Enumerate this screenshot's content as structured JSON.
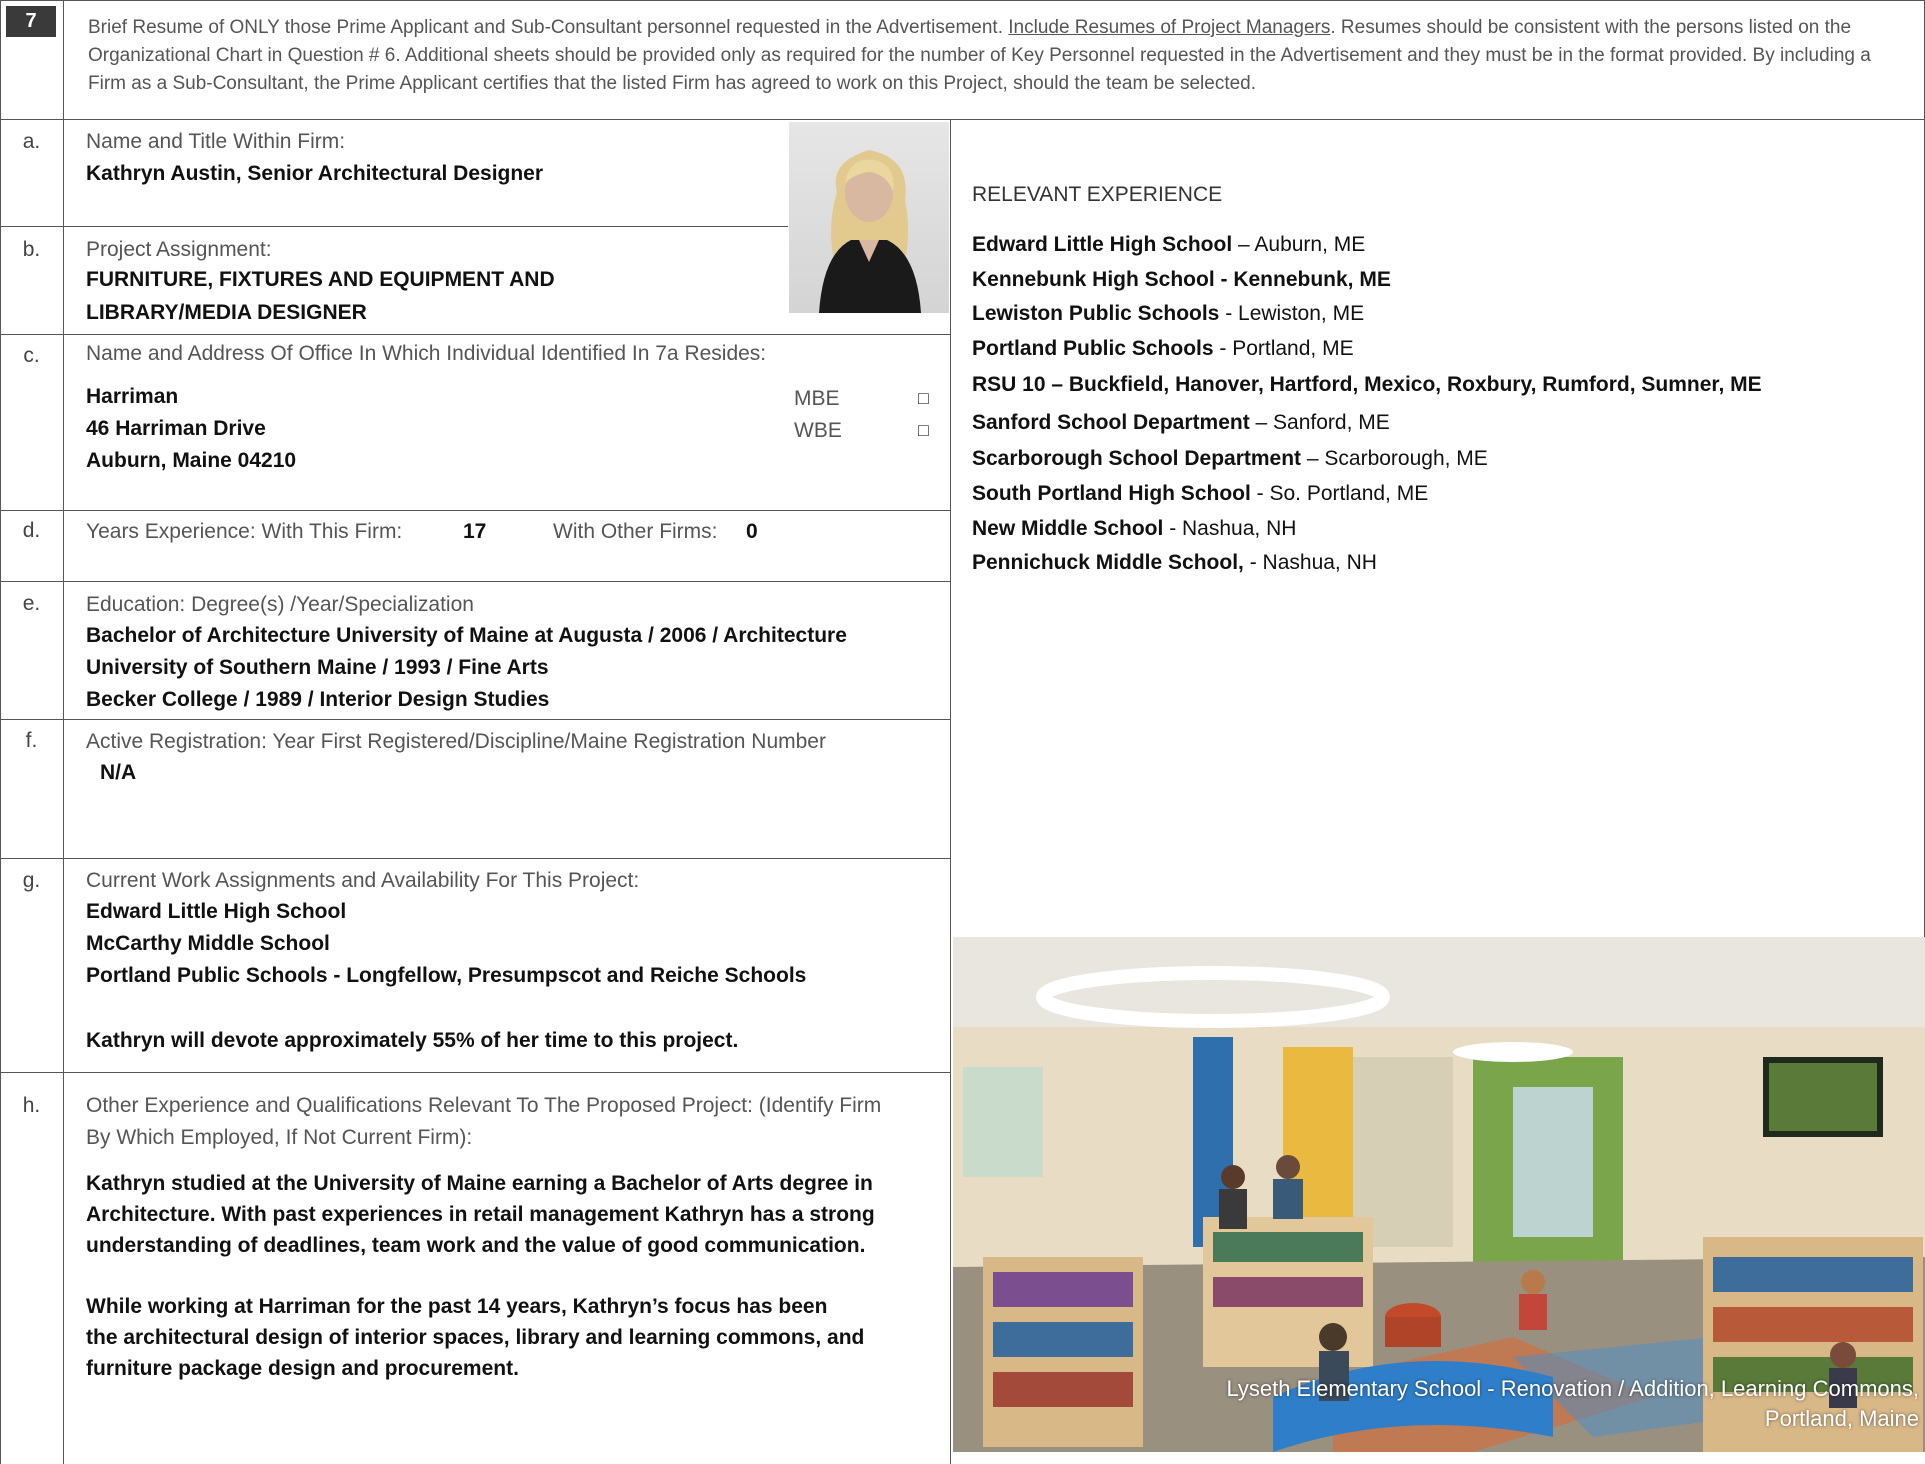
{
  "header": {
    "number": "7",
    "text_before": "Brief Resume of ONLY those Prime Applicant and Sub-Consultant personnel requested in the Advertisement. ",
    "text_underlined": "Include Resumes of Project Managers",
    "text_after": ". Resumes should be consistent with the persons listed on the Organizational Chart in Question # 6. Additional sheets should be provided only as required for the number of Key Personnel requested in the Advertisement and they must be in the format provided. By including a Firm as a Sub-Consultant, the Prime Applicant certifies that the listed Firm has agreed to work on this Project, should the team be selected."
  },
  "sections": {
    "a": {
      "letter": "a.",
      "label": "Name and Title Within Firm:",
      "value": "Kathryn Austin, Senior Architectural Designer"
    },
    "b": {
      "letter": "b.",
      "label": "Project Assignment:",
      "line1": "FURNITURE, FIXTURES AND EQUIPMENT AND",
      "line2": "LIBRARY/MEDIA DESIGNER"
    },
    "c": {
      "letter": "c.",
      "label": "Name and Address Of Office In Which Individual Identified In 7a Resides:",
      "lines": [
        "Harriman",
        "46 Harriman Drive",
        "Auburn, Maine 04210"
      ],
      "mbe": "MBE",
      "wbe": "WBE",
      "checkbox": "□"
    },
    "d": {
      "letter": "d.",
      "label": "Years Experience:  With This Firm:",
      "firm_years": "17",
      "other_label": "With Other Firms:",
      "other_years": "0"
    },
    "e": {
      "letter": "e.",
      "label": "Education:  Degree(s) /Year/Specialization",
      "lines": [
        "Bachelor of Architecture University of Maine at Augusta / 2006 / Architecture",
        "University of Southern Maine / 1993 / Fine Arts",
        "Becker College / 1989 / Interior Design Studies"
      ]
    },
    "f": {
      "letter": "f.",
      "label": "Active Registration:  Year First Registered/Discipline/Maine Registration Number",
      "value": "N/A"
    },
    "g": {
      "letter": "g.",
      "label": "Current Work Assignments and Availability For This Project:",
      "lines": [
        "Edward Little High School",
        "McCarthy Middle School",
        "Portland Public Schools - Longfellow, Presumpscot and Reiche Schools"
      ],
      "availability": "Kathryn will devote approximately 55% of her time to this project."
    },
    "h": {
      "letter": "h.",
      "label_line1": "Other Experience and Qualifications Relevant To The Proposed Project: (Identify Firm",
      "label_line2": "By Which Employed, If Not Current Firm):",
      "para1": [
        "Kathryn studied at the University of Maine earning a Bachelor of Arts degree in",
        "Architecture. With past experiences in retail management Kathryn has a strong",
        "understanding of deadlines, team work and the value of good communication."
      ],
      "para2_bold": "While working at Harriman for the past 14 years, Kathryn’s focus has been",
      "para2": [
        "the architectural design of interior spaces, library and learning commons, and",
        "furniture package design and procurement."
      ]
    }
  },
  "experience": {
    "title": "RELEVANT EXPERIENCE",
    "items": [
      {
        "name": "Edward Little High School",
        "loc": " – Auburn, ME",
        "all_bold": false
      },
      {
        "name": "Kennebunk High School - Kennebunk, ME",
        "loc": "",
        "all_bold": true
      },
      {
        "name": "Lewiston Public Schools",
        "loc": " - Lewiston, ME",
        "all_bold": false
      },
      {
        "name": "Portland Public Schools",
        "loc": " - Portland, ME",
        "all_bold": false
      },
      {
        "name": "RSU 10 – Buckfield, Hanover, Hartford, Mexico, Roxbury, Rumford, Sumner, ME",
        "loc": "",
        "all_bold": true
      },
      {
        "name": "Sanford School Department",
        "loc": " – Sanford, ME",
        "all_bold": false
      },
      {
        "name": "Scarborough School Department",
        "loc": " – Scarborough, ME",
        "all_bold": false
      },
      {
        "name": "South Portland High School",
        "loc": " - So. Portland, ME",
        "all_bold": false
      },
      {
        "name": "New Middle School",
        "loc": " - Nashua, NH",
        "all_bold": false
      },
      {
        "name": "Pennichuck Middle School, ",
        "loc": "- Nashua, NH",
        "all_bold": false
      }
    ]
  },
  "photo_caption": {
    "line1": "Lyseth Elementary School - Renovation / Addition, Learning Commons,",
    "line2": "Portland, Maine"
  },
  "colors": {
    "number_badge": "#3a3a3a",
    "border": "#555555",
    "label": "#555555"
  }
}
